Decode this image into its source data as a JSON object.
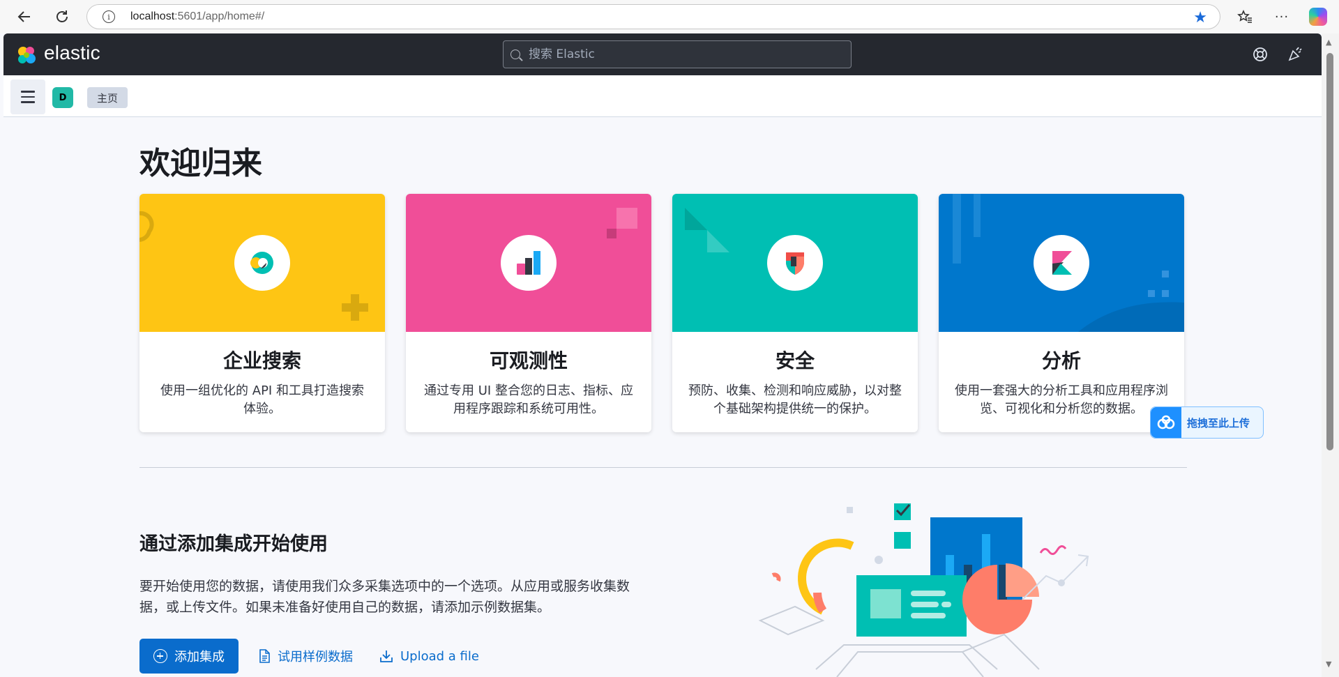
{
  "browser": {
    "url_host": "localhost",
    "url_rest": ":5601/app/home#/",
    "info_glyph": "i"
  },
  "header": {
    "brand": "elastic",
    "search_placeholder": "搜索 Elastic"
  },
  "subbar": {
    "space_initial": "D",
    "breadcrumb": "主页"
  },
  "main": {
    "welcome": "欢迎归来",
    "solutions": [
      {
        "title": "企业搜索",
        "description": "使用一组优化的 API 和工具打造搜索体验。",
        "color": "#fec514",
        "icon": "enterprise-search-icon"
      },
      {
        "title": "可观测性",
        "description": "通过专用 UI 整合您的日志、指标、应用程序跟踪和系统可用性。",
        "color": "#f04e98",
        "icon": "observability-icon"
      },
      {
        "title": "安全",
        "description": "预防、收集、检测和响应威胁，以对整个基础架构提供统一的保护。",
        "color": "#00bfb3",
        "icon": "security-icon"
      },
      {
        "title": "分析",
        "description": "使用一套强大的分析工具和应用程序浏览、可视化和分析您的数据。",
        "color": "#0077cc",
        "icon": "analytics-icon"
      }
    ],
    "integrations": {
      "title": "通过添加集成开始使用",
      "description": "要开始使用您的数据，请使用我们众多采集选项中的一个选项。从应用或服务收集数据，或上传文件。如果未准备好使用自己的数据，请添加示例数据集。",
      "add_button": "添加集成",
      "sample_link": "试用样例数据",
      "upload_link": "Upload a file"
    }
  },
  "overlay": {
    "upload_widget": "拖拽至此上传"
  }
}
